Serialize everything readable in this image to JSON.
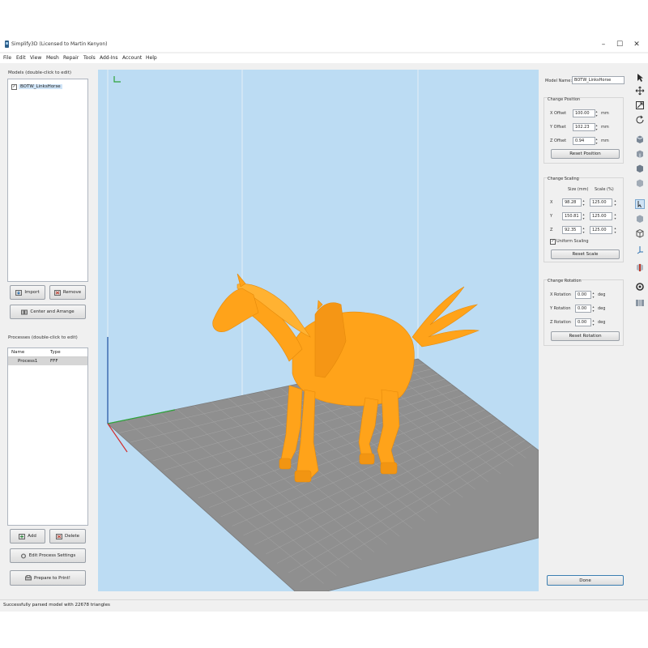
{
  "window": {
    "title": "Simplify3D (Licensed to Martin Kenyon)",
    "controls": {
      "minimize": "–",
      "maximize": "☐",
      "close": "✕"
    }
  },
  "menu": [
    "File",
    "Edit",
    "View",
    "Mesh",
    "Repair",
    "Tools",
    "Add-Ins",
    "Account",
    "Help"
  ],
  "models": {
    "label": "Models (double-click to edit)",
    "items": [
      {
        "name": "BOTW_LinksHorse",
        "checked": true
      }
    ],
    "import_label": "Import",
    "remove_label": "Remove",
    "center_label": "Center and Arrange"
  },
  "processes": {
    "label": "Processes (double-click to edit)",
    "col_name": "Name",
    "col_type": "Type",
    "rows": [
      {
        "name": "Process1",
        "type": "FFF"
      }
    ],
    "add_label": "Add",
    "delete_label": "Delete",
    "edit_label": "Edit Process Settings",
    "prepare_label": "Prepare to Print!"
  },
  "model_panel": {
    "model_name_label": "Model Name:",
    "model_name_value": "BOTW_LinksHorse",
    "position": {
      "title": "Change Position",
      "x_label": "X Offset",
      "x_value": "100.00",
      "y_label": "Y Offset",
      "y_value": "102.23",
      "z_label": "Z Offset",
      "z_value": "0.94",
      "unit": "mm",
      "reset_label": "Reset Position"
    },
    "scaling": {
      "title": "Change Scaling",
      "size_header": "Size (mm)",
      "scale_header": "Scale (%)",
      "rows": [
        {
          "axis": "X",
          "size": "98.28",
          "scale": "125.00"
        },
        {
          "axis": "Y",
          "size": "150.81",
          "scale": "125.00"
        },
        {
          "axis": "Z",
          "size": "92.35",
          "scale": "125.00"
        }
      ],
      "uniform_label": "Uniform Scaling",
      "reset_label": "Reset Scale"
    },
    "rotation": {
      "title": "Change Rotation",
      "x_label": "X Rotation",
      "x_value": "0.00",
      "y_label": "Y Rotation",
      "y_value": "0.00",
      "z_label": "Z Rotation",
      "z_value": "0.00",
      "unit": "deg",
      "reset_label": "Reset Rotation"
    },
    "done_label": "Done"
  },
  "toolbar_icons": [
    "select-arrow-icon",
    "move-icon",
    "zoom-icon",
    "rotate-view-icon",
    "view-cube-top-icon",
    "view-cube-front-icon",
    "view-cube-side-icon",
    "view-cube-iso-icon",
    "select-model-icon",
    "solid-cube-icon",
    "wireframe-icon",
    "axis-icon",
    "cross-section-icon",
    "gear-icon",
    "columns-icon"
  ],
  "status": {
    "text": "Successfully parsed model with 22678 triangles"
  },
  "colors": {
    "model": "#ffa31a",
    "bed": "#8f8f8f",
    "viewport": "#bcdcf3",
    "accent": "#3c7fb1"
  }
}
